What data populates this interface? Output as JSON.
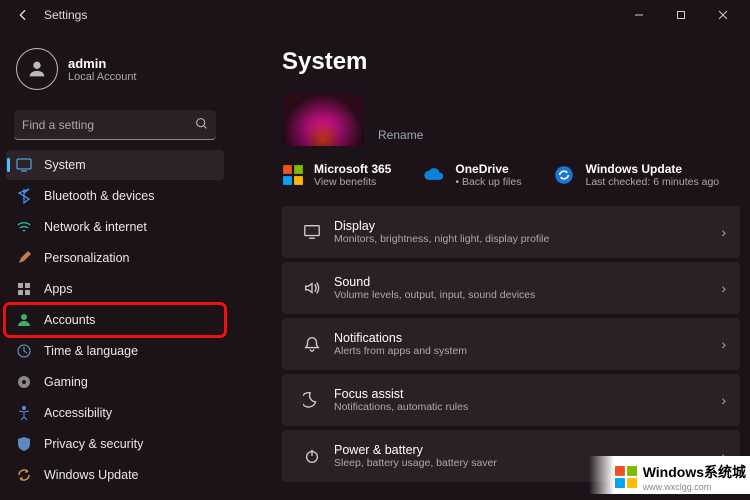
{
  "window": {
    "title": "Settings"
  },
  "user": {
    "name": "admin",
    "account_type": "Local Account"
  },
  "search": {
    "placeholder": "Find a setting"
  },
  "sidebar": {
    "items": [
      {
        "id": "system",
        "label": "System",
        "selected": true
      },
      {
        "id": "bluetooth",
        "label": "Bluetooth & devices"
      },
      {
        "id": "network",
        "label": "Network & internet"
      },
      {
        "id": "personalization",
        "label": "Personalization"
      },
      {
        "id": "apps",
        "label": "Apps"
      },
      {
        "id": "accounts",
        "label": "Accounts",
        "highlighted": true
      },
      {
        "id": "time",
        "label": "Time & language"
      },
      {
        "id": "gaming",
        "label": "Gaming"
      },
      {
        "id": "accessibility",
        "label": "Accessibility"
      },
      {
        "id": "privacy",
        "label": "Privacy & security"
      },
      {
        "id": "update",
        "label": "Windows Update"
      }
    ]
  },
  "main": {
    "title": "System",
    "rename_label": "Rename",
    "promos": [
      {
        "id": "m365",
        "title": "Microsoft 365",
        "sub": "View benefits"
      },
      {
        "id": "onedrive",
        "title": "OneDrive",
        "sub": "• Back up files"
      },
      {
        "id": "update",
        "title": "Windows Update",
        "sub": "Last checked: 6 minutes ago"
      }
    ],
    "cards": [
      {
        "id": "display",
        "title": "Display",
        "sub": "Monitors, brightness, night light, display profile"
      },
      {
        "id": "sound",
        "title": "Sound",
        "sub": "Volume levels, output, input, sound devices"
      },
      {
        "id": "notifications",
        "title": "Notifications",
        "sub": "Alerts from apps and system"
      },
      {
        "id": "focus",
        "title": "Focus assist",
        "sub": "Notifications, automatic rules"
      },
      {
        "id": "power",
        "title": "Power & battery",
        "sub": "Sleep, battery usage, battery saver"
      }
    ]
  },
  "watermark": {
    "text": "Windows系统城",
    "url": "www.wxclgg.com"
  }
}
